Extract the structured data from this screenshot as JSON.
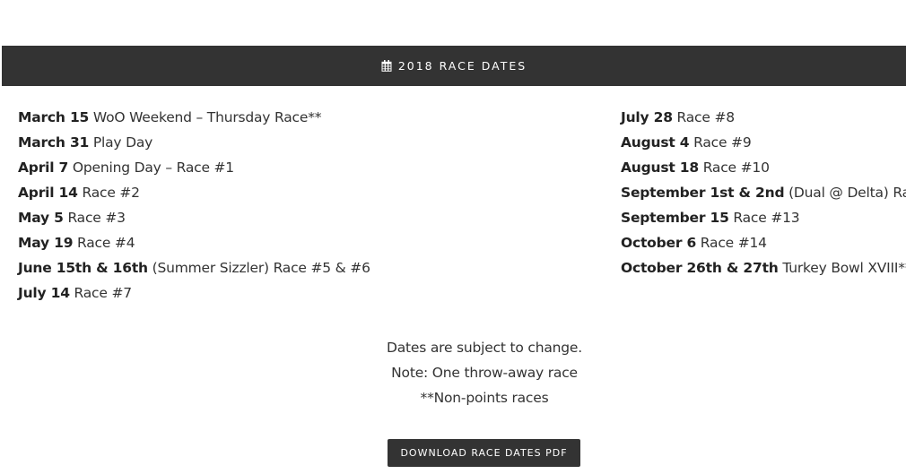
{
  "header": {
    "icon": "calendar-icon",
    "title": "2018 RACE DATES"
  },
  "schedule": {
    "left": [
      {
        "date": "March 15",
        "event": "WoO Weekend – Thursday Race**"
      },
      {
        "date": "March 31",
        "event": "Play Day"
      },
      {
        "date": "April 7",
        "event": "Opening Day – Race #1"
      },
      {
        "date": "April 14",
        "event": "Race #2"
      },
      {
        "date": "May 5",
        "event": "Race #3"
      },
      {
        "date": "May 19",
        "event": "Race #4"
      },
      {
        "date": "June 15th & 16th",
        "event": "(Summer Sizzler) Race #5 & #6"
      },
      {
        "date": "July 14",
        "event": "Race #7"
      }
    ],
    "right": [
      {
        "date": "July 28",
        "event": "Race #8"
      },
      {
        "date": "August 4",
        "event": "Race #9"
      },
      {
        "date": "August 18",
        "event": "Race #10"
      },
      {
        "date": "September 1st & 2nd",
        "event": "(Dual @ Delta) Race"
      },
      {
        "date": "September 15",
        "event": "Race #13"
      },
      {
        "date": "October 6",
        "event": "Race #14"
      },
      {
        "date": "October 26th & 27th",
        "event": "Turkey Bowl XVIII**"
      }
    ]
  },
  "notes": [
    "Dates are subject to change.",
    "Note: One throw-away race",
    "**Non-points races"
  ],
  "download_button": {
    "label": "DOWNLOAD RACE DATES PDF"
  },
  "colors": {
    "bar_background": "#333333",
    "bar_text": "#ffffff",
    "body_text": "#333333"
  }
}
